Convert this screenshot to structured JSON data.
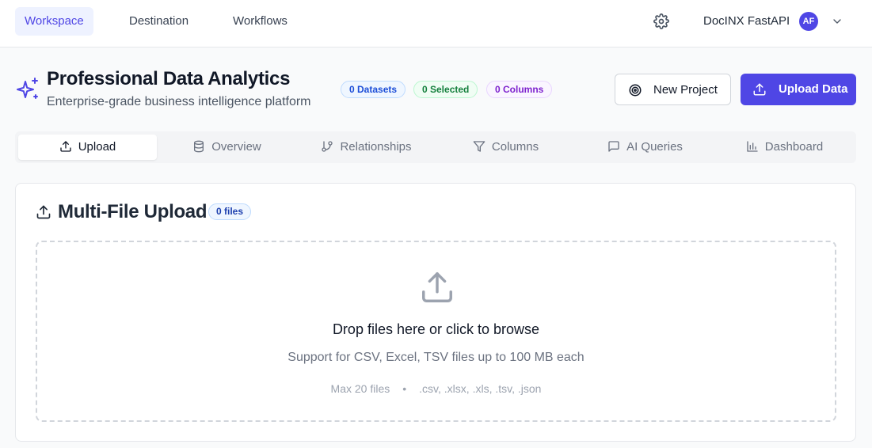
{
  "nav": {
    "tabs": [
      "Workspace",
      "Destination",
      "Workflows"
    ],
    "active": "Workspace",
    "user_name": "DocINX FastAPI",
    "avatar_initials": "AF"
  },
  "header": {
    "title": "Professional Data Analytics",
    "subtitle": "Enterprise-grade business intelligence platform",
    "badges": [
      "0 Datasets",
      "0 Selected",
      "0 Columns"
    ],
    "new_project_label": "New Project",
    "upload_label": "Upload Data"
  },
  "tabs": [
    {
      "label": "Upload",
      "icon": "upload-icon"
    },
    {
      "label": "Overview",
      "icon": "database-icon"
    },
    {
      "label": "Relationships",
      "icon": "git-branch-icon"
    },
    {
      "label": "Columns",
      "icon": "filter-icon"
    },
    {
      "label": "AI Queries",
      "icon": "message-square-icon"
    },
    {
      "label": "Dashboard",
      "icon": "bar-chart-icon"
    }
  ],
  "upload_card": {
    "title": "Multi-File Upload",
    "file_count": "0 files",
    "drop_title": "Drop files here or click to browse",
    "drop_subtitle": "Support for CSV, Excel, TSV files up to 100 MB each",
    "max_files": "Max 20 files",
    "separator": "•",
    "extensions": ".csv, .xlsx, .xls, .tsv, .json"
  },
  "colors": {
    "accent": "#4f46e5",
    "accent_light": "#eef2ff"
  }
}
